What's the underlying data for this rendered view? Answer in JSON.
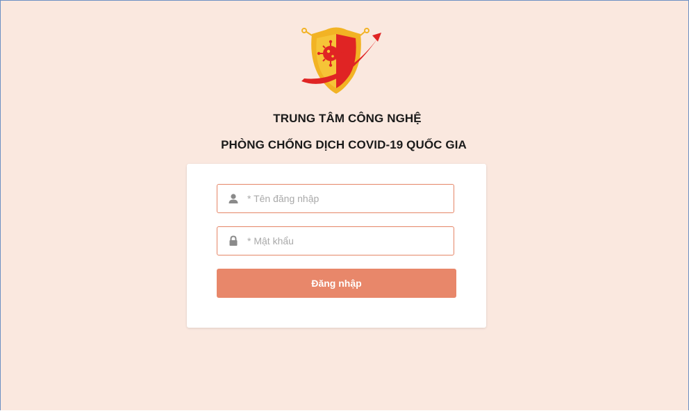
{
  "header": {
    "title_line1": "TRUNG TÂM CÔNG NGHỆ",
    "title_line2": "PHÒNG CHỐNG DỊCH COVID-19 QUỐC GIA"
  },
  "login_form": {
    "username": {
      "placeholder": "* Tên đăng nhập",
      "value": "",
      "icon": "user-icon"
    },
    "password": {
      "placeholder": "* Mật khẩu",
      "value": "",
      "icon": "lock-icon"
    },
    "submit_label": "Đăng nhập"
  },
  "colors": {
    "page_background": "#fae8df",
    "accent": "#e8876a",
    "field_border": "#e58566",
    "logo_red": "#e02424",
    "logo_yellow": "#f5b820"
  }
}
